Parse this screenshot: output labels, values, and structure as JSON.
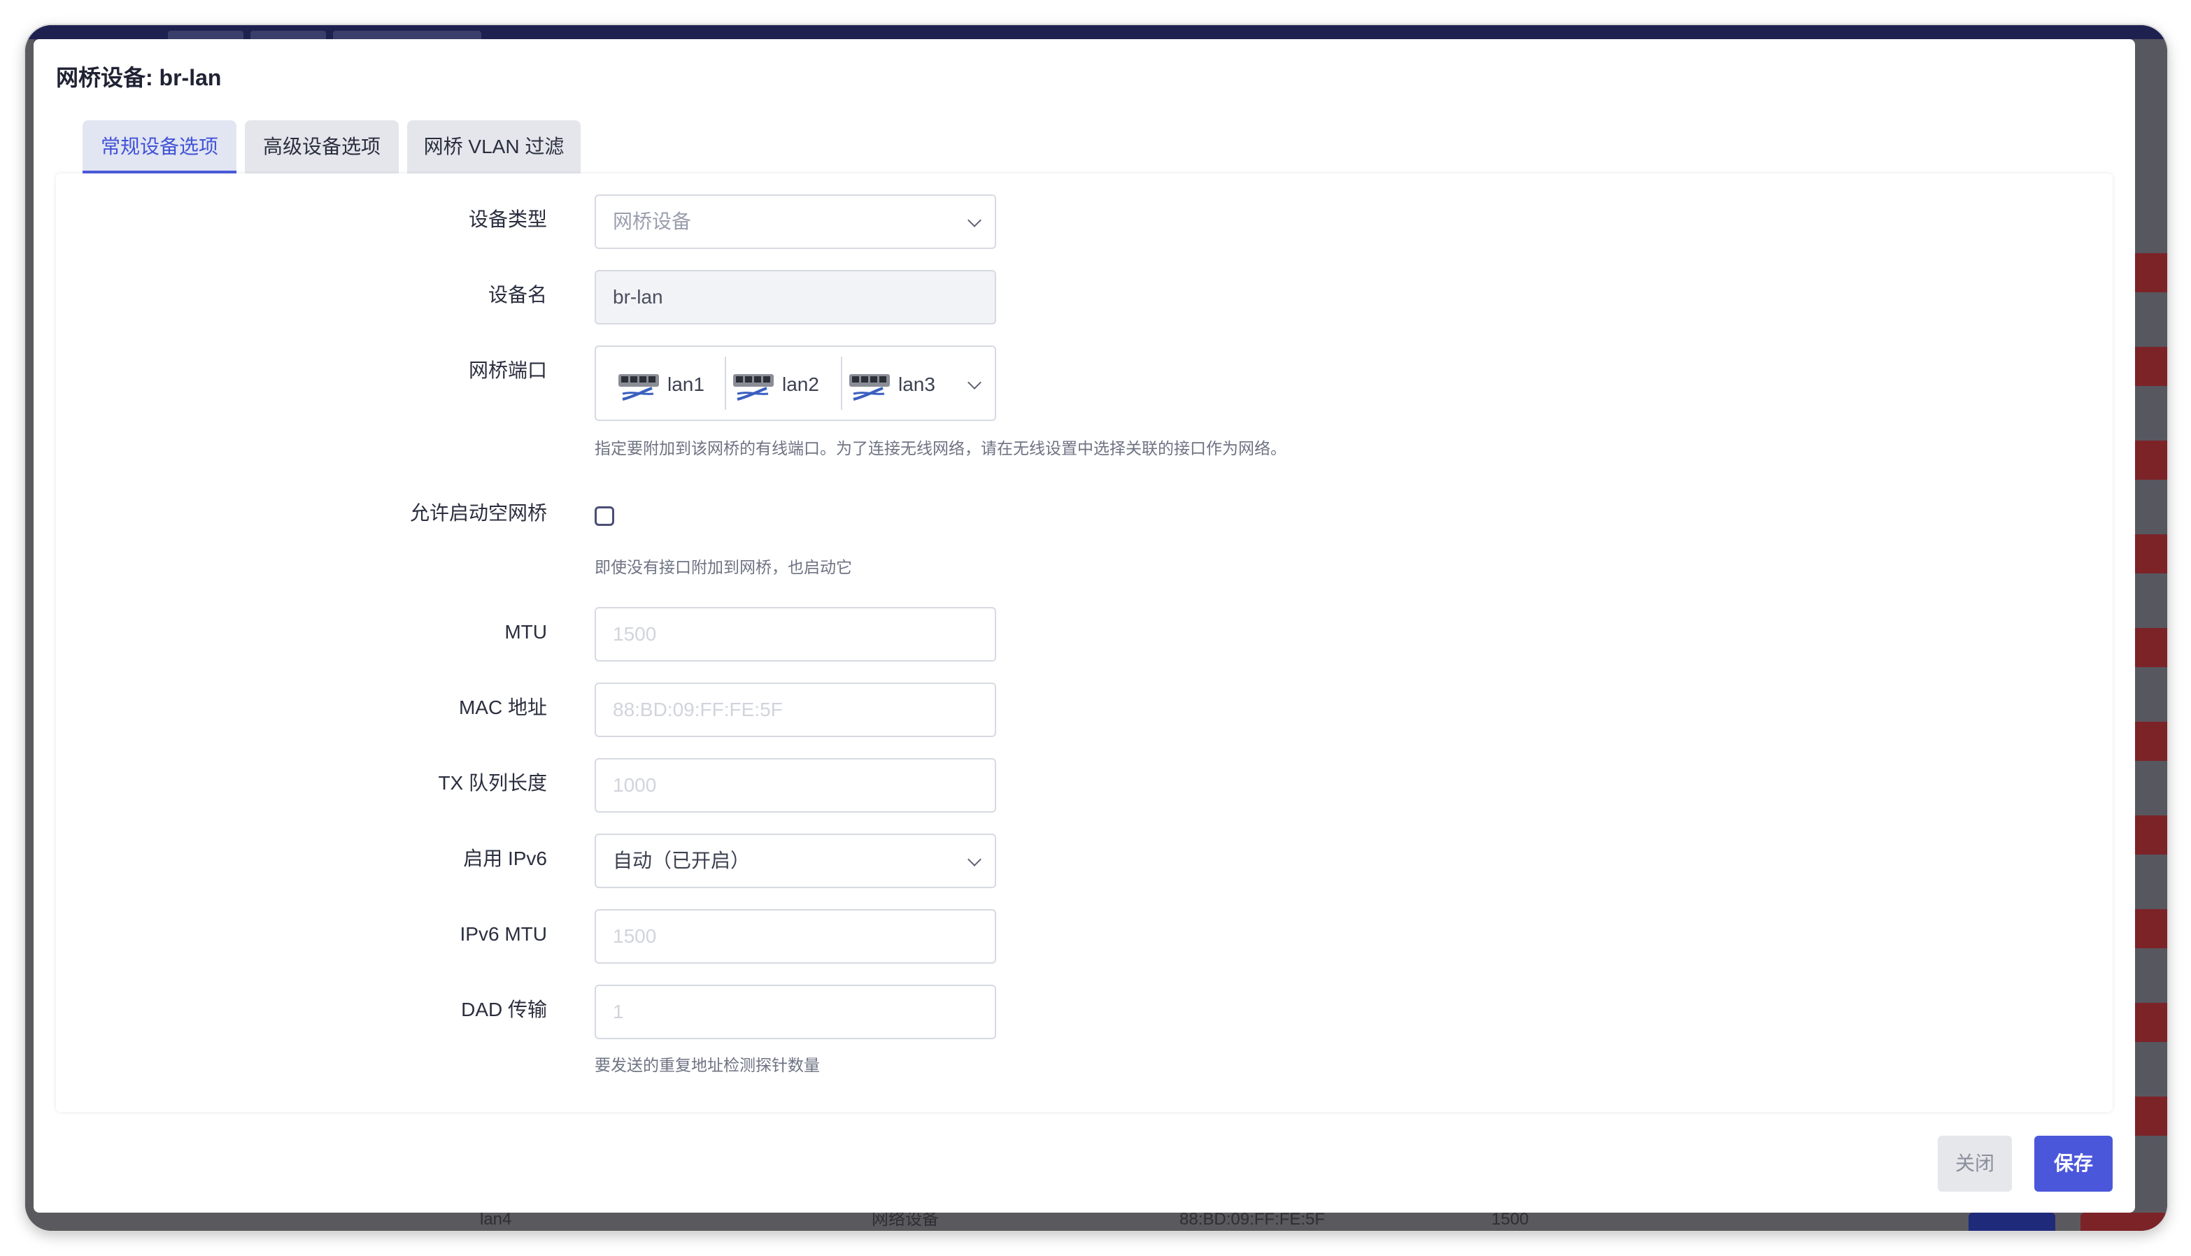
{
  "dialog": {
    "title": "网桥设备: br-lan"
  },
  "tabs": [
    {
      "label": "常规设备选项",
      "active": true
    },
    {
      "label": "高级设备选项",
      "active": false
    },
    {
      "label": "网桥 VLAN 过滤",
      "active": false
    }
  ],
  "form": {
    "device_type": {
      "label": "设备类型",
      "value": "网桥设备"
    },
    "device_name": {
      "label": "设备名",
      "value": "br-lan"
    },
    "bridge_ports": {
      "label": "网桥端口",
      "ports": [
        "lan1",
        "lan2",
        "lan3"
      ],
      "help": "指定要附加到该网桥的有线端口。为了连接无线网络，请在无线设置中选择关联的接口作为网络。"
    },
    "bring_up_empty": {
      "label": "允许启动空网桥",
      "checked": false,
      "help": "即使没有接口附加到网桥，也启动它"
    },
    "mtu": {
      "label": "MTU",
      "placeholder": "1500"
    },
    "mac": {
      "label": "MAC 地址",
      "placeholder": "88:BD:09:FF:FE:5F"
    },
    "txqueuelen": {
      "label": "TX 队列长度",
      "placeholder": "1000"
    },
    "ipv6": {
      "label": "启用 IPv6",
      "value": "自动（已开启）"
    },
    "ipv6_mtu": {
      "label": "IPv6 MTU",
      "placeholder": "1500"
    },
    "dad": {
      "label": "DAD 传输",
      "placeholder": "1",
      "help": "要发送的重复地址检测探针数量"
    }
  },
  "footer": {
    "close_label": "关闭",
    "save_label": "保存"
  },
  "background": {
    "row_port": "lan4",
    "row_type": "网络设备",
    "row_mac": "88:BD:09:FF:FE:5F",
    "row_mtu": "1500"
  }
}
